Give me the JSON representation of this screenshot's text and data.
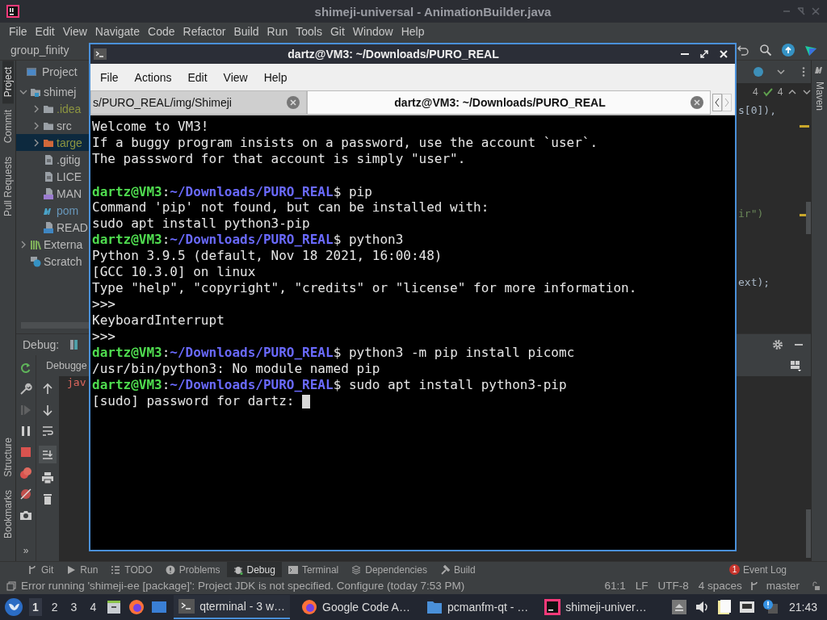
{
  "ide": {
    "title": "shimeji-universal - AnimationBuilder.java",
    "menu": [
      "File",
      "Edit",
      "View",
      "Navigate",
      "Code",
      "Refactor",
      "Build",
      "Run",
      "Tools",
      "Git",
      "Window",
      "Help"
    ],
    "breadcrumb": "group_finity",
    "left_tools_top": [
      {
        "label": "Project",
        "selected": true
      },
      {
        "label": "Commit",
        "selected": false
      },
      {
        "label": "Pull Requests",
        "selected": false
      }
    ],
    "left_tools_bottom": [
      {
        "label": "Structure",
        "selected": false
      },
      {
        "label": "Bookmarks",
        "selected": false
      }
    ],
    "right_tool": "Maven",
    "project": {
      "title": "Project",
      "tree": [
        {
          "label": "shimej",
          "kind": "module",
          "expanded": true,
          "selected": false,
          "color": "#bbbbbb",
          "children": [
            {
              "label": ".idea",
              "kind": "folder",
              "expanded": false,
              "selected": false,
              "color": "#8c9440"
            },
            {
              "label": "src",
              "kind": "folder",
              "expanded": false,
              "selected": false,
              "color": "#bbbbbb"
            },
            {
              "label": "targe",
              "kind": "excluded",
              "expanded": false,
              "selected": true,
              "color": "#8c9440"
            },
            {
              "label": ".gitig",
              "kind": "file",
              "selected": false,
              "color": "#bbbbbb"
            },
            {
              "label": "LICE",
              "kind": "file",
              "selected": false,
              "color": "#bbbbbb"
            },
            {
              "label": "MAN",
              "kind": "manifest",
              "selected": false,
              "color": "#bbbbbb"
            },
            {
              "label": "pom",
              "kind": "maven",
              "selected": false,
              "color": "#6897bb"
            },
            {
              "label": "READ",
              "kind": "markdown",
              "selected": false,
              "color": "#bbbbbb"
            }
          ]
        },
        {
          "label": "Externa",
          "kind": "library",
          "expanded": false,
          "selected": false,
          "color": "#bbbbbb"
        },
        {
          "label": "Scratch",
          "kind": "scratch",
          "selected": false,
          "color": "#bbbbbb"
        }
      ]
    },
    "counters": [
      "4",
      "4"
    ],
    "code_fragments": [
      "s[0]),",
      "ir\")",
      "ext);"
    ],
    "debug": {
      "title": "Debug:",
      "tab": "Debugge",
      "console": "jav",
      "more": "»"
    },
    "tool_tabs": [
      {
        "label": "Git",
        "kind": "git",
        "selected": false
      },
      {
        "label": "Run",
        "kind": "run",
        "selected": false
      },
      {
        "label": "TODO",
        "kind": "todo",
        "selected": false
      },
      {
        "label": "Problems",
        "kind": "problems",
        "selected": false
      },
      {
        "label": "Debug",
        "kind": "debug",
        "selected": true
      },
      {
        "label": "Terminal",
        "kind": "terminal",
        "selected": false
      },
      {
        "label": "Dependencies",
        "kind": "dependencies",
        "selected": false
      },
      {
        "label": "Build",
        "kind": "build",
        "selected": false
      }
    ],
    "event_log": {
      "count": "1",
      "label": "Event Log"
    },
    "status": {
      "message": "Error running 'shimeji-ee [package]': Project JDK is not specified. Configure (today 7:53 PM)",
      "items": [
        "61:1",
        "LF",
        "UTF-8",
        "4 spaces"
      ],
      "branch": "master"
    }
  },
  "terminal": {
    "title": "dartz@VM3: ~/Downloads/PURO_REAL",
    "menu": [
      "File",
      "Actions",
      "Edit",
      "View",
      "Help"
    ],
    "tabs": [
      {
        "label": "s/PURO_REAL/img/Shimeji",
        "selected": false
      },
      {
        "label": "dartz@VM3: ~/Downloads/PURO_REAL",
        "selected": true
      }
    ],
    "lines": [
      {
        "blank_before": false,
        "cursor": false,
        "segments": [
          {
            "kind": "plain",
            "text": "Welcome to VM3!"
          }
        ]
      },
      {
        "blank_before": false,
        "cursor": false,
        "segments": [
          {
            "kind": "plain",
            "text": "If a buggy program insists on a password, use the account `user`."
          }
        ]
      },
      {
        "blank_before": false,
        "cursor": false,
        "segments": [
          {
            "kind": "plain",
            "text": "The passsword for that account is simply \"user\"."
          }
        ]
      },
      {
        "blank_before": true,
        "cursor": false,
        "segments": [
          {
            "kind": "user",
            "text": "dartz@VM3"
          },
          {
            "kind": "plain",
            "text": ":"
          },
          {
            "kind": "path",
            "text": "~/Downloads/PURO_REAL"
          },
          {
            "kind": "plain",
            "text": "$ pip"
          }
        ]
      },
      {
        "blank_before": false,
        "cursor": false,
        "segments": [
          {
            "kind": "plain",
            "text": "Command 'pip' not found, but can be installed with:"
          }
        ]
      },
      {
        "blank_before": false,
        "cursor": false,
        "segments": [
          {
            "kind": "plain",
            "text": "sudo apt install python3-pip"
          }
        ]
      },
      {
        "blank_before": false,
        "cursor": false,
        "segments": [
          {
            "kind": "user",
            "text": "dartz@VM3"
          },
          {
            "kind": "plain",
            "text": ":"
          },
          {
            "kind": "path",
            "text": "~/Downloads/PURO_REAL"
          },
          {
            "kind": "plain",
            "text": "$ python3"
          }
        ]
      },
      {
        "blank_before": false,
        "cursor": false,
        "segments": [
          {
            "kind": "plain",
            "text": "Python 3.9.5 (default, Nov 18 2021, 16:00:48)"
          }
        ]
      },
      {
        "blank_before": false,
        "cursor": false,
        "segments": [
          {
            "kind": "plain",
            "text": "[GCC 10.3.0] on linux"
          }
        ]
      },
      {
        "blank_before": false,
        "cursor": false,
        "segments": [
          {
            "kind": "plain",
            "text": "Type \"help\", \"copyright\", \"credits\" or \"license\" for more information."
          }
        ]
      },
      {
        "blank_before": false,
        "cursor": false,
        "segments": [
          {
            "kind": "plain",
            "text": ">>>"
          }
        ]
      },
      {
        "blank_before": false,
        "cursor": false,
        "segments": [
          {
            "kind": "plain",
            "text": "KeyboardInterrupt"
          }
        ]
      },
      {
        "blank_before": false,
        "cursor": false,
        "segments": [
          {
            "kind": "plain",
            "text": ">>>"
          }
        ]
      },
      {
        "blank_before": false,
        "cursor": false,
        "segments": [
          {
            "kind": "user",
            "text": "dartz@VM3"
          },
          {
            "kind": "plain",
            "text": ":"
          },
          {
            "kind": "path",
            "text": "~/Downloads/PURO_REAL"
          },
          {
            "kind": "plain",
            "text": "$ python3 -m pip install picomc"
          }
        ]
      },
      {
        "blank_before": false,
        "cursor": false,
        "segments": [
          {
            "kind": "plain",
            "text": "/usr/bin/python3: No module named pip"
          }
        ]
      },
      {
        "blank_before": false,
        "cursor": false,
        "segments": [
          {
            "kind": "user",
            "text": "dartz@VM3"
          },
          {
            "kind": "plain",
            "text": ":"
          },
          {
            "kind": "path",
            "text": "~/Downloads/PURO_REAL"
          },
          {
            "kind": "plain",
            "text": "$ sudo apt install python3-pip"
          }
        ]
      },
      {
        "blank_before": false,
        "cursor": true,
        "segments": [
          {
            "kind": "plain",
            "text": "[sudo] password for dartz: "
          }
        ]
      }
    ]
  },
  "taskbar": {
    "desktops": [
      {
        "label": "1",
        "selected": true
      },
      {
        "label": "2",
        "selected": false
      },
      {
        "label": "3",
        "selected": false
      },
      {
        "label": "4",
        "selected": false
      }
    ],
    "tasks": [
      {
        "label": "qterminal - 3 w…",
        "kind": "terminal",
        "selected": true
      },
      {
        "label": "Google Code A…",
        "kind": "browser",
        "selected": false
      },
      {
        "label": "pcmanfm-qt - …",
        "kind": "folder",
        "selected": false
      },
      {
        "label": "shimeji-univer…",
        "kind": "ide",
        "selected": false
      }
    ],
    "clock": "21:43"
  }
}
